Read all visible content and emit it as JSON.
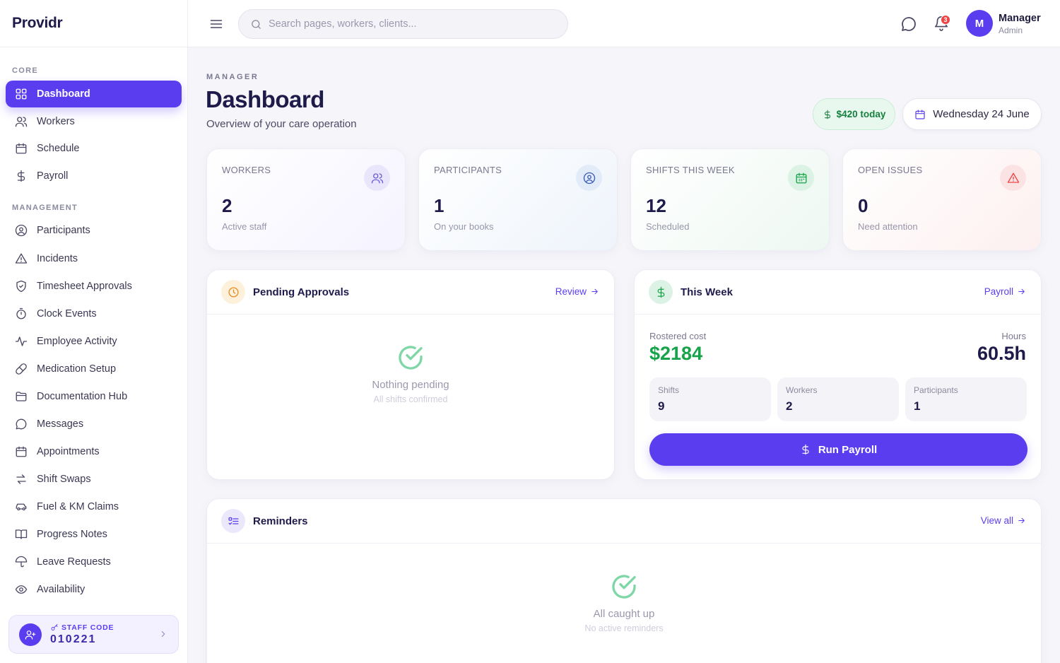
{
  "brand": {
    "name": "Providr"
  },
  "sidebar": {
    "sections": [
      {
        "label": "CORE"
      },
      {
        "label": "MANAGEMENT"
      }
    ],
    "items": [
      {
        "label": "Dashboard",
        "icon": "grid-icon"
      },
      {
        "label": "Workers",
        "icon": "users-icon"
      },
      {
        "label": "Schedule",
        "icon": "calendar-icon"
      },
      {
        "label": "Payroll",
        "icon": "dollar-icon"
      },
      {
        "label": "Participants",
        "icon": "user-circle-icon"
      },
      {
        "label": "Incidents",
        "icon": "alert-triangle-icon"
      },
      {
        "label": "Timesheet Approvals",
        "icon": "shield-check-icon"
      },
      {
        "label": "Clock Events",
        "icon": "stopwatch-icon"
      },
      {
        "label": "Employee Activity",
        "icon": "activity-icon"
      },
      {
        "label": "Medication Setup",
        "icon": "pill-icon"
      },
      {
        "label": "Documentation Hub",
        "icon": "folder-icon"
      },
      {
        "label": "Messages",
        "icon": "message-icon"
      },
      {
        "label": "Appointments",
        "icon": "calendar-icon"
      },
      {
        "label": "Shift Swaps",
        "icon": "swap-icon"
      },
      {
        "label": "Fuel & KM Claims",
        "icon": "car-icon"
      },
      {
        "label": "Progress Notes",
        "icon": "book-icon"
      },
      {
        "label": "Leave Requests",
        "icon": "umbrella-icon"
      },
      {
        "label": "Availability",
        "icon": "eye-icon"
      }
    ],
    "staff_code": {
      "label": "STAFF CODE",
      "value": "010221"
    }
  },
  "topbar": {
    "search_placeholder": "Search pages, workers, clients...",
    "notification_count": "3",
    "user": {
      "initial": "M",
      "name": "Manager",
      "role": "Admin"
    }
  },
  "header": {
    "eyebrow": "MANAGER",
    "title": "Dashboard",
    "subtitle": "Overview of your care operation",
    "today_amount": "$420 today",
    "date": "Wednesday 24 June"
  },
  "stats": [
    {
      "label": "WORKERS",
      "value": "2",
      "sub": "Active staff",
      "icon": "users-icon",
      "accent": "#6d5dd3"
    },
    {
      "label": "PARTICIPANTS",
      "value": "1",
      "sub": "On your books",
      "icon": "user-circle-icon",
      "accent": "#3b5bb8"
    },
    {
      "label": "SHIFTS THIS WEEK",
      "value": "12",
      "sub": "Scheduled",
      "icon": "calendar-icon",
      "accent": "#16a34a"
    },
    {
      "label": "OPEN ISSUES",
      "value": "0",
      "sub": "Need attention",
      "icon": "alert-triangle-icon",
      "accent": "#ef4444"
    }
  ],
  "pending": {
    "title": "Pending Approvals",
    "link": "Review",
    "empty_title": "Nothing pending",
    "empty_sub": "All shifts confirmed"
  },
  "week": {
    "title": "This Week",
    "link": "Payroll",
    "cost_label": "Rostered cost",
    "cost_value": "$2184",
    "hours_label": "Hours",
    "hours_value": "60.5h",
    "mini": [
      {
        "label": "Shifts",
        "value": "9"
      },
      {
        "label": "Workers",
        "value": "2"
      },
      {
        "label": "Participants",
        "value": "1"
      }
    ],
    "button": "Run Payroll"
  },
  "reminders": {
    "title": "Reminders",
    "link": "View all",
    "empty_title": "All caught up",
    "empty_sub": "No active reminders"
  },
  "colors": {
    "accent": "#5b3df0",
    "success": "#16a34a",
    "danger": "#ef4444"
  }
}
